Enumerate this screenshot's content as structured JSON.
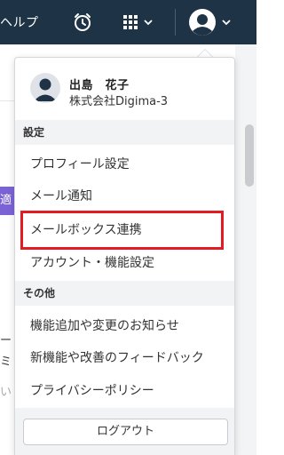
{
  "topbar": {
    "help_label": "ヘルプ",
    "icons": [
      "alarm-clock-icon",
      "apps-grid-icon",
      "user-avatar-icon"
    ]
  },
  "background": {
    "tag_text": "適",
    "text_1": "ート",
    "text_2": "ミ",
    "text_3": "い"
  },
  "user": {
    "name": "出島　花子",
    "company": "株式会社Digima-3"
  },
  "menu": {
    "settings_header": "設定",
    "settings_items": [
      {
        "label": "プロフィール設定"
      },
      {
        "label": "メール通知"
      },
      {
        "label": "メールボックス連携"
      },
      {
        "label": "アカウント・機能設定"
      }
    ],
    "other_header": "その他",
    "other_items": [
      {
        "label": "機能追加や変更のお知らせ"
      },
      {
        "label": "新機能や改善のフィードバック"
      },
      {
        "label": "プライバシーポリシー"
      }
    ],
    "logout_label": "ログアウト"
  },
  "colors": {
    "topbar": "#1f3346",
    "highlight_border": "#e31b23",
    "section_bg": "#f2f3f5"
  }
}
